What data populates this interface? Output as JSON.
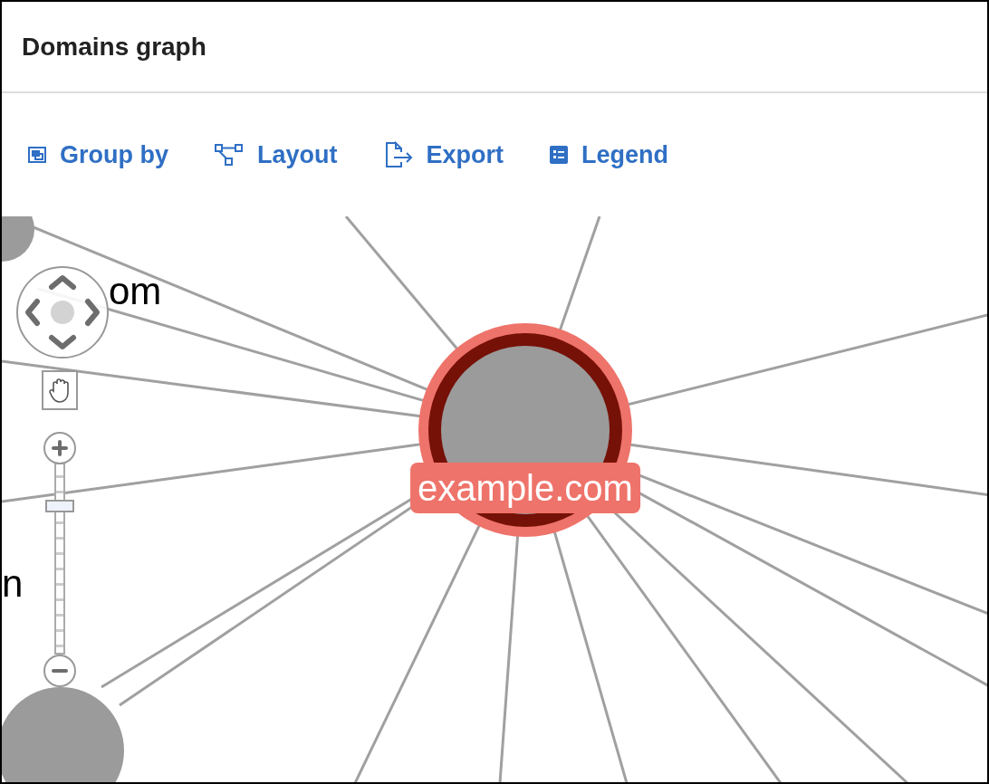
{
  "window": {
    "title": "Domains graph"
  },
  "toolbar": [
    {
      "label": "Group by",
      "kind": "group"
    },
    {
      "label": "Layout",
      "kind": "layout"
    },
    {
      "label": "Export",
      "kind": "export"
    },
    {
      "label": "Legend",
      "kind": "legend"
    }
  ],
  "graph": {
    "nodes": [
      {
        "label": "example.com",
        "selected": true
      },
      {
        "label": "om",
        "selected": false
      },
      {
        "label": "n",
        "selected": false
      }
    ]
  },
  "zoom_slider": {
    "level": 0.76
  }
}
